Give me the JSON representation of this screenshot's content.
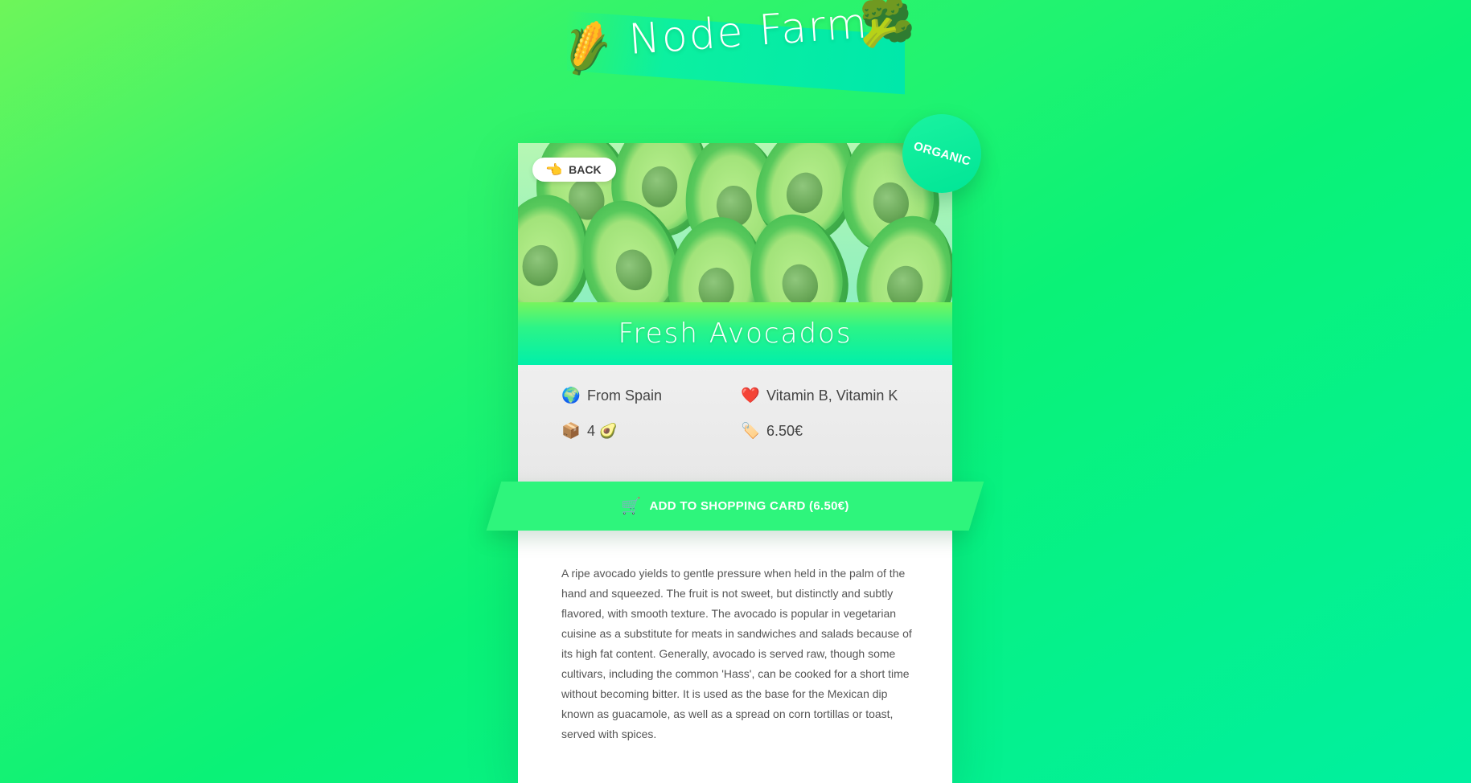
{
  "header": {
    "logo_title": "Node Farm"
  },
  "product": {
    "title": "Fresh Avocados",
    "badge": "ORGANIC",
    "from": "From Spain",
    "nutrients": "Vitamin B, Vitamin K",
    "quantity": "4 🥑",
    "price": "6.50€",
    "description": "A ripe avocado yields to gentle pressure when held in the palm of the hand and squeezed. The fruit is not sweet, but distinctly and subtly flavored, with smooth texture. The avocado is popular in vegetarian cuisine as a substitute for meats in sandwiches and salads because of its high fat content. Generally, avocado is served raw, though some cultivars, including the common 'Hass', can be cooked for a short time without becoming bitter. It is used as the base for the Mexican dip known as guacamole, as well as a spread on corn tortillas or toast, served with spices."
  },
  "actions": {
    "back_label": "BACK",
    "add_to_cart_label": "ADD TO SHOPPING CARD (6.50€)"
  },
  "icons": {
    "corn": "🌽",
    "broccoli": "🥦",
    "back_hand": "👈",
    "globe": "🌍",
    "heart": "❤️",
    "package": "📦",
    "price_tag": "🏷️",
    "cart": "🛒"
  },
  "colors": {
    "accent": "#2ef57c",
    "badge": "#00e596",
    "title_band_top": "#78f45d",
    "title_band_bottom": "#00f0aa"
  }
}
